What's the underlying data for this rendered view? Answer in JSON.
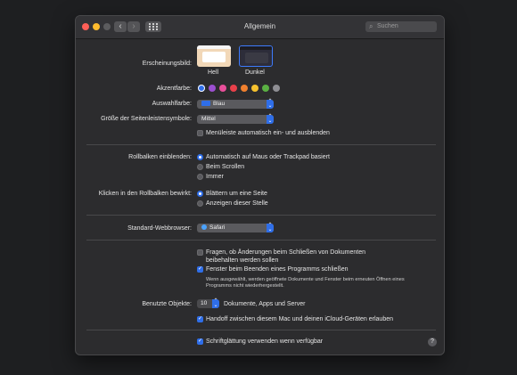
{
  "window": {
    "title": "Allgemein",
    "search_placeholder": "Suchen",
    "nav_back": "‹",
    "nav_forward": "›",
    "search_icon": "⌕"
  },
  "appearance": {
    "label": "Erscheinungsbild:",
    "options": [
      {
        "label": "Hell",
        "selected": false
      },
      {
        "label": "Dunkel",
        "selected": true
      }
    ]
  },
  "accent": {
    "label": "Akzentfarbe:",
    "colors": [
      "#2f6ee8",
      "#9b4fd0",
      "#e84f9a",
      "#e8404a",
      "#f0802e",
      "#f5c12e",
      "#5ab043",
      "#8e8e93"
    ],
    "selected_index": 0
  },
  "highlight": {
    "label": "Auswahlfarbe:",
    "value": "Blau",
    "chip_color": "#2f6ee8"
  },
  "sidebar_icon_size": {
    "label": "Größe der Seitenleistensymbole:",
    "value": "Mittel"
  },
  "menubar": {
    "label": "Menüleiste automatisch ein- und ausblenden",
    "checked": false
  },
  "scrollbars": {
    "label": "Rollbalken einblenden:",
    "options": [
      {
        "label": "Automatisch auf Maus oder Trackpad basiert",
        "selected": true
      },
      {
        "label": "Beim Scrollen",
        "selected": false
      },
      {
        "label": "Immer",
        "selected": false
      }
    ]
  },
  "click_scroll": {
    "label": "Klicken in den Rollbalken bewirkt:",
    "options": [
      {
        "label": "Blättern um eine Seite",
        "selected": true
      },
      {
        "label": "Anzeigen dieser Stelle",
        "selected": false
      }
    ]
  },
  "browser": {
    "label": "Standard-Webbrowser:",
    "value": "Safari"
  },
  "documents": {
    "ask_label_line1": "Fragen, ob Änderungen beim Schließen von Dokumenten",
    "ask_label_line2": "beibehalten werden sollen",
    "ask_checked": false,
    "close_label": "Fenster beim Beenden eines Programms schließen",
    "close_checked": true,
    "note_line1": "Wenn ausgewählt, werden geöffnete Dokumente und Fenster beim erneuten Öffnen eines",
    "note_line2": "Programms nicht wiederhergestellt."
  },
  "recent": {
    "label": "Benutzte Objekte:",
    "value": "10",
    "suffix": "Dokumente, Apps und Server"
  },
  "handoff": {
    "label": "Handoff zwischen diesem Mac und deinen iCloud-Geräten erlauben",
    "checked": true
  },
  "font_smoothing": {
    "label": "Schriftglättung verwenden wenn verfügbar",
    "checked": true
  },
  "help": "?"
}
